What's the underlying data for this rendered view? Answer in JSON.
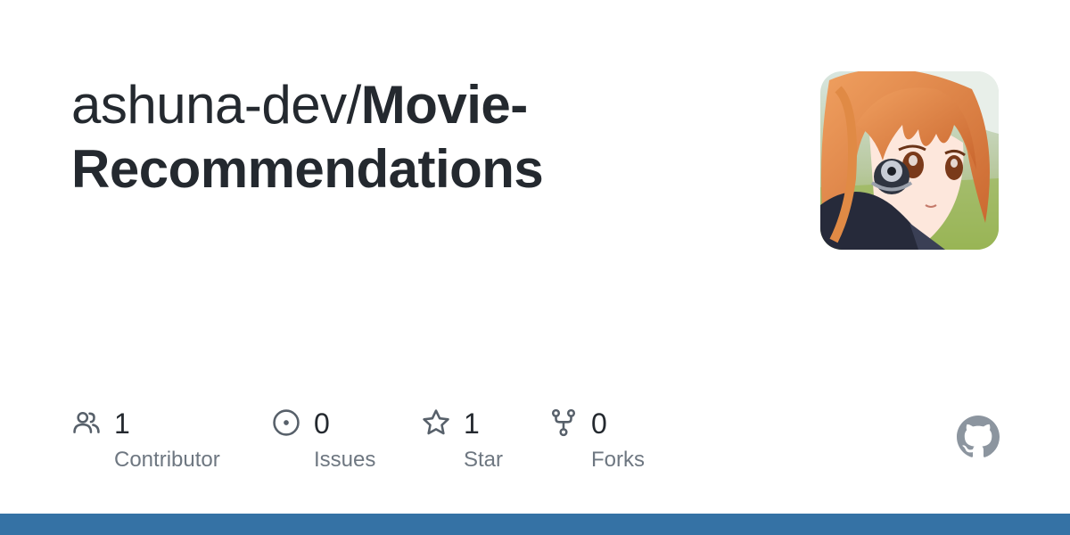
{
  "repo": {
    "owner": "ashuna-dev/",
    "name": "Movie-Recommendations"
  },
  "stats": {
    "contributors": {
      "count": "1",
      "label": "Contributor"
    },
    "issues": {
      "count": "0",
      "label": "Issues"
    },
    "stars": {
      "count": "1",
      "label": "Star"
    },
    "forks": {
      "count": "0",
      "label": "Forks"
    }
  },
  "colors": {
    "text": "#24292f",
    "muted": "#6e7781",
    "icon": "#57606a",
    "bar": "#3572A5"
  },
  "icons": {
    "contributors": "people-icon",
    "issues": "issue-opened-icon",
    "stars": "star-icon",
    "forks": "repo-forked-icon",
    "brand": "github-mark-icon"
  }
}
